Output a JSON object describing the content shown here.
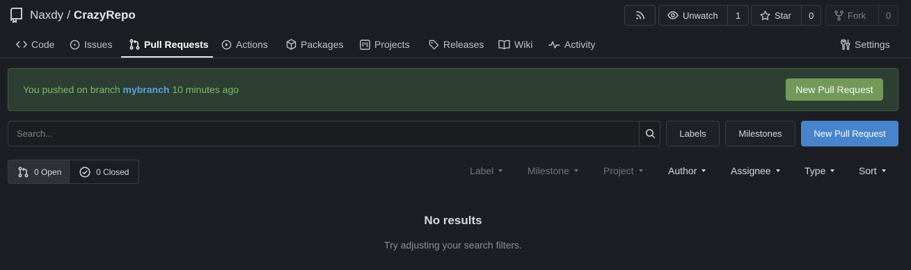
{
  "repo": {
    "owner": "Naxdy",
    "separator": "/",
    "name": "CrazyRepo"
  },
  "header_actions": {
    "rss_icon": "rss-icon",
    "watch": {
      "label": "Unwatch",
      "count": "1",
      "icon": "eye-icon"
    },
    "star": {
      "label": "Star",
      "count": "0",
      "icon": "star-icon"
    },
    "fork": {
      "label": "Fork",
      "count": "0",
      "icon": "fork-icon"
    }
  },
  "tabs": [
    {
      "label": "Code",
      "icon": "code-icon"
    },
    {
      "label": "Issues",
      "icon": "issue-icon"
    },
    {
      "label": "Pull Requests",
      "icon": "pull-request-icon",
      "active": true
    },
    {
      "label": "Actions",
      "icon": "play-icon"
    },
    {
      "label": "Packages",
      "icon": "package-icon"
    },
    {
      "label": "Projects",
      "icon": "project-icon"
    },
    {
      "label": "Releases",
      "icon": "tag-icon"
    },
    {
      "label": "Wiki",
      "icon": "book-icon"
    },
    {
      "label": "Activity",
      "icon": "pulse-icon"
    },
    {
      "label": "Settings",
      "icon": "tools-icon"
    }
  ],
  "flash": {
    "prefix": "You pushed on branch",
    "branch": "mybranch",
    "suffix": "10 minutes ago",
    "button_label": "New Pull Request"
  },
  "search": {
    "placeholder": "Search...",
    "value": ""
  },
  "toolbar": {
    "labels": "Labels",
    "milestones": "Milestones",
    "new_pr": "New Pull Request"
  },
  "state": {
    "open": "0 Open",
    "closed": "0 Closed"
  },
  "filters": [
    {
      "label": "Label",
      "enabled": false
    },
    {
      "label": "Milestone",
      "enabled": false
    },
    {
      "label": "Project",
      "enabled": false
    },
    {
      "label": "Author",
      "enabled": true
    },
    {
      "label": "Assignee",
      "enabled": true
    },
    {
      "label": "Type",
      "enabled": true
    },
    {
      "label": "Sort",
      "enabled": true
    }
  ],
  "empty": {
    "title": "No results",
    "subtitle": "Try adjusting your search filters."
  },
  "colors": {
    "background": "#1c1e23",
    "flash_bg": "#2d3e32",
    "flash_text": "#7cbc6a",
    "branch_link": "#5aa2e0",
    "green_button": "#73995a",
    "primary_button": "#4884cc"
  }
}
